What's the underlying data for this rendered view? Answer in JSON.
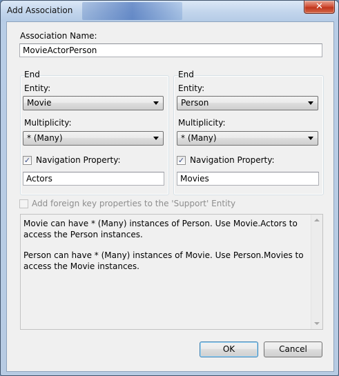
{
  "window": {
    "title": "Add Association",
    "close_glyph": "✕"
  },
  "association_name": {
    "label": "Association Name:",
    "value": "MovieActorPerson"
  },
  "end_left": {
    "group_label": "End",
    "entity_label": "Entity:",
    "entity_value": "Movie",
    "multiplicity_label": "Multiplicity:",
    "multiplicity_value": "* (Many)",
    "nav_checked": true,
    "nav_label": "Navigation Property:",
    "nav_value": "Actors"
  },
  "end_right": {
    "group_label": "End",
    "entity_label": "Entity:",
    "entity_value": "Person",
    "multiplicity_label": "Multiplicity:",
    "multiplicity_value": "* (Many)",
    "nav_checked": true,
    "nav_label": "Navigation Property:",
    "nav_value": "Movies"
  },
  "foreign_key": {
    "checked": false,
    "enabled": false,
    "label": "Add foreign key properties to the 'Support' Entity"
  },
  "info": {
    "line1": "Movie can have * (Many) instances of Person. Use Movie.Actors to access the Person instances.",
    "line2": "Person can have * (Many) instances of Movie. Use Person.Movies to access the Movie instances."
  },
  "buttons": {
    "ok": "OK",
    "cancel": "Cancel"
  },
  "icons": {
    "checkmark": "✓"
  }
}
